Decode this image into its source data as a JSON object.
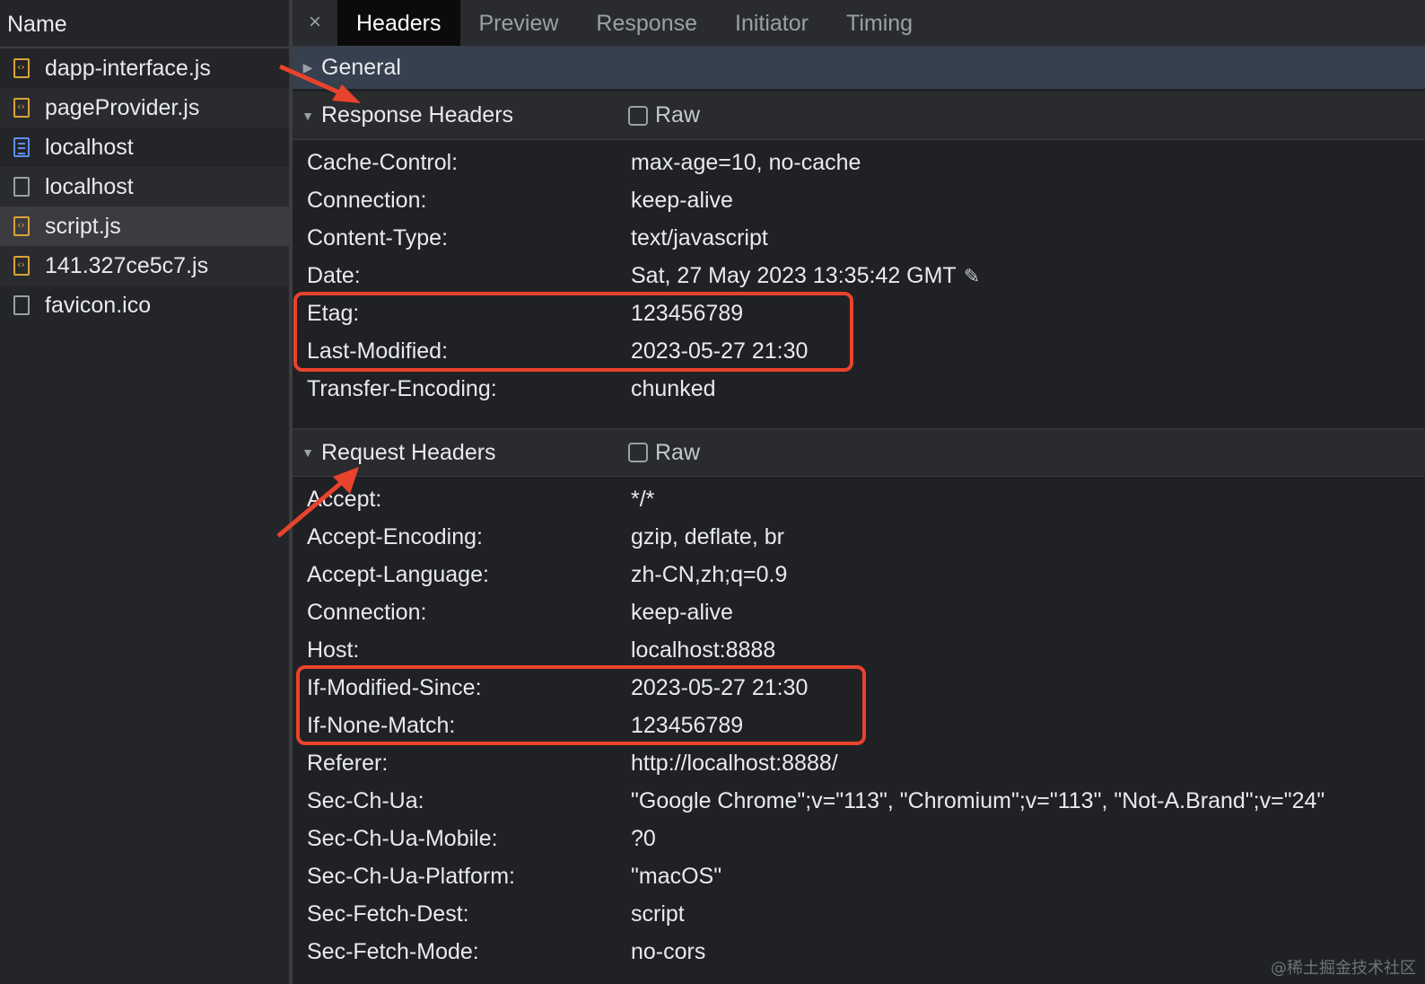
{
  "sidebar": {
    "header": "Name",
    "files": [
      {
        "name": "dapp-interface.js",
        "icon": "js-file-icon"
      },
      {
        "name": "pageProvider.js",
        "icon": "js-file-icon"
      },
      {
        "name": "localhost",
        "icon": "document-icon"
      },
      {
        "name": "localhost",
        "icon": "blank-file-icon"
      },
      {
        "name": "script.js",
        "icon": "js-file-icon",
        "selected": true
      },
      {
        "name": "141.327ce5c7.js",
        "icon": "js-file-icon"
      },
      {
        "name": "favicon.ico",
        "icon": "blank-file-icon"
      }
    ]
  },
  "tabs": {
    "close": "×",
    "items": [
      "Headers",
      "Preview",
      "Response",
      "Initiator",
      "Timing"
    ],
    "active": "Headers"
  },
  "sections": {
    "general": "General",
    "response": "Response Headers",
    "request": "Request Headers",
    "raw_label": "Raw"
  },
  "response_headers": [
    {
      "name": "Cache-Control:",
      "value": "max-age=10, no-cache"
    },
    {
      "name": "Connection:",
      "value": "keep-alive"
    },
    {
      "name": "Content-Type:",
      "value": "text/javascript"
    },
    {
      "name": "Date:",
      "value": "Sat, 27 May 2023 13:35:42 GMT"
    },
    {
      "name": "Etag:",
      "value": "123456789"
    },
    {
      "name": "Last-Modified:",
      "value": "2023-05-27 21:30"
    },
    {
      "name": "Transfer-Encoding:",
      "value": "chunked"
    }
  ],
  "request_headers": [
    {
      "name": "Accept:",
      "value": "*/*"
    },
    {
      "name": "Accept-Encoding:",
      "value": "gzip, deflate, br"
    },
    {
      "name": "Accept-Language:",
      "value": "zh-CN,zh;q=0.9"
    },
    {
      "name": "Connection:",
      "value": "keep-alive"
    },
    {
      "name": "Host:",
      "value": "localhost:8888"
    },
    {
      "name": "If-Modified-Since:",
      "value": "2023-05-27 21:30"
    },
    {
      "name": "If-None-Match:",
      "value": "123456789"
    },
    {
      "name": "Referer:",
      "value": "http://localhost:8888/"
    },
    {
      "name": "Sec-Ch-Ua:",
      "value": "\"Google Chrome\";v=\"113\", \"Chromium\";v=\"113\", \"Not-A.Brand\";v=\"24\""
    },
    {
      "name": "Sec-Ch-Ua-Mobile:",
      "value": "?0"
    },
    {
      "name": "Sec-Ch-Ua-Platform:",
      "value": "\"macOS\""
    },
    {
      "name": "Sec-Fetch-Dest:",
      "value": "script"
    },
    {
      "name": "Sec-Fetch-Mode:",
      "value": "no-cors"
    }
  ],
  "colors": {
    "background": "#202124",
    "active_tab": "#0b0b0c",
    "general_bar": "#36404f",
    "annotation": "#e8432d",
    "js_icon": "#d9a33a",
    "doc_icon": "#5e8ef0"
  },
  "watermark": "@稀土掘金技术社区"
}
